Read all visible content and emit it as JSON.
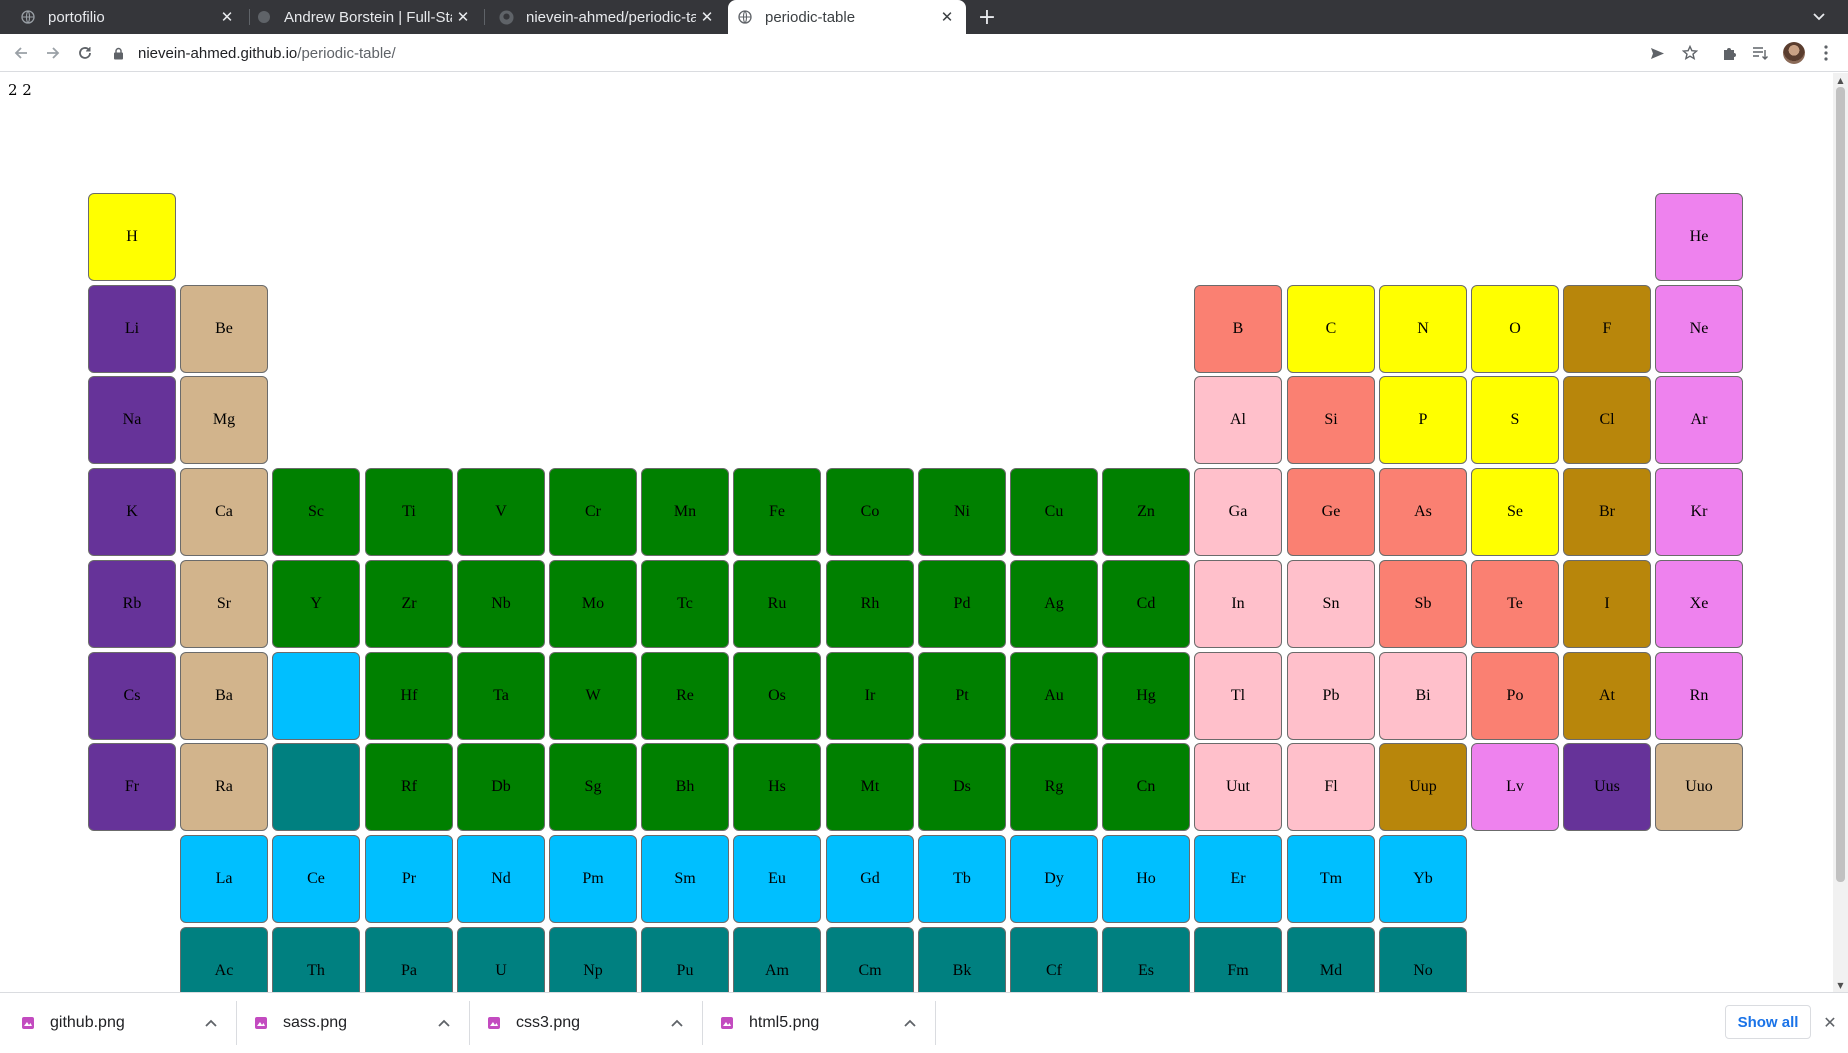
{
  "tabs": [
    {
      "title": "portofilio",
      "close": "✕"
    },
    {
      "title": "Andrew Borstein | Full-Stack",
      "close": "✕"
    },
    {
      "title": "nievein-ahmed/periodic-table",
      "close": "✕"
    },
    {
      "title": "periodic-table",
      "close": "✕",
      "active": true
    }
  ],
  "toolbar": {
    "url_host": "nievein-ahmed.github.io",
    "url_path": "/periodic-table/"
  },
  "page": {
    "corner_text": "2 2"
  },
  "colors": {
    "alkali": "#663399",
    "alkaline": "#d2b48c",
    "transition": "#008000",
    "lanthanide": "#00bfff",
    "actinide": "#008080",
    "metalloid": "#fa8072",
    "post_transition": "#ffc0cb",
    "nonmetal": "#ffff00",
    "halogen": "#b8860b",
    "noble": "#ee82ee"
  },
  "elements": [
    {
      "symbol": "H",
      "row": 1,
      "col": 1,
      "group": "nonmetal"
    },
    {
      "symbol": "He",
      "row": 1,
      "col": 18,
      "group": "noble"
    },
    {
      "symbol": "Li",
      "row": 2,
      "col": 1,
      "group": "alkali"
    },
    {
      "symbol": "Be",
      "row": 2,
      "col": 2,
      "group": "alkaline"
    },
    {
      "symbol": "B",
      "row": 2,
      "col": 13,
      "group": "metalloid"
    },
    {
      "symbol": "C",
      "row": 2,
      "col": 14,
      "group": "nonmetal"
    },
    {
      "symbol": "N",
      "row": 2,
      "col": 15,
      "group": "nonmetal"
    },
    {
      "symbol": "O",
      "row": 2,
      "col": 16,
      "group": "nonmetal"
    },
    {
      "symbol": "F",
      "row": 2,
      "col": 17,
      "group": "halogen"
    },
    {
      "symbol": "Ne",
      "row": 2,
      "col": 18,
      "group": "noble"
    },
    {
      "symbol": "Na",
      "row": 3,
      "col": 1,
      "group": "alkali"
    },
    {
      "symbol": "Mg",
      "row": 3,
      "col": 2,
      "group": "alkaline"
    },
    {
      "symbol": "Al",
      "row": 3,
      "col": 13,
      "group": "post_transition"
    },
    {
      "symbol": "Si",
      "row": 3,
      "col": 14,
      "group": "metalloid"
    },
    {
      "symbol": "P",
      "row": 3,
      "col": 15,
      "group": "nonmetal"
    },
    {
      "symbol": "S",
      "row": 3,
      "col": 16,
      "group": "nonmetal"
    },
    {
      "symbol": "Cl",
      "row": 3,
      "col": 17,
      "group": "halogen"
    },
    {
      "symbol": "Ar",
      "row": 3,
      "col": 18,
      "group": "noble"
    },
    {
      "symbol": "K",
      "row": 4,
      "col": 1,
      "group": "alkali"
    },
    {
      "symbol": "Ca",
      "row": 4,
      "col": 2,
      "group": "alkaline"
    },
    {
      "symbol": "Sc",
      "row": 4,
      "col": 3,
      "group": "transition"
    },
    {
      "symbol": "Ti",
      "row": 4,
      "col": 4,
      "group": "transition"
    },
    {
      "symbol": "V",
      "row": 4,
      "col": 5,
      "group": "transition"
    },
    {
      "symbol": "Cr",
      "row": 4,
      "col": 6,
      "group": "transition"
    },
    {
      "symbol": "Mn",
      "row": 4,
      "col": 7,
      "group": "transition"
    },
    {
      "symbol": "Fe",
      "row": 4,
      "col": 8,
      "group": "transition"
    },
    {
      "symbol": "Co",
      "row": 4,
      "col": 9,
      "group": "transition"
    },
    {
      "symbol": "Ni",
      "row": 4,
      "col": 10,
      "group": "transition"
    },
    {
      "symbol": "Cu",
      "row": 4,
      "col": 11,
      "group": "transition"
    },
    {
      "symbol": "Zn",
      "row": 4,
      "col": 12,
      "group": "transition"
    },
    {
      "symbol": "Ga",
      "row": 4,
      "col": 13,
      "group": "post_transition"
    },
    {
      "symbol": "Ge",
      "row": 4,
      "col": 14,
      "group": "metalloid"
    },
    {
      "symbol": "As",
      "row": 4,
      "col": 15,
      "group": "metalloid"
    },
    {
      "symbol": "Se",
      "row": 4,
      "col": 16,
      "group": "nonmetal"
    },
    {
      "symbol": "Br",
      "row": 4,
      "col": 17,
      "group": "halogen"
    },
    {
      "symbol": "Kr",
      "row": 4,
      "col": 18,
      "group": "noble"
    },
    {
      "symbol": "Rb",
      "row": 5,
      "col": 1,
      "group": "alkali"
    },
    {
      "symbol": "Sr",
      "row": 5,
      "col": 2,
      "group": "alkaline"
    },
    {
      "symbol": "Y",
      "row": 5,
      "col": 3,
      "group": "transition"
    },
    {
      "symbol": "Zr",
      "row": 5,
      "col": 4,
      "group": "transition"
    },
    {
      "symbol": "Nb",
      "row": 5,
      "col": 5,
      "group": "transition"
    },
    {
      "symbol": "Mo",
      "row": 5,
      "col": 6,
      "group": "transition"
    },
    {
      "symbol": "Tc",
      "row": 5,
      "col": 7,
      "group": "transition"
    },
    {
      "symbol": "Ru",
      "row": 5,
      "col": 8,
      "group": "transition"
    },
    {
      "symbol": "Rh",
      "row": 5,
      "col": 9,
      "group": "transition"
    },
    {
      "symbol": "Pd",
      "row": 5,
      "col": 10,
      "group": "transition"
    },
    {
      "symbol": "Ag",
      "row": 5,
      "col": 11,
      "group": "transition"
    },
    {
      "symbol": "Cd",
      "row": 5,
      "col": 12,
      "group": "transition"
    },
    {
      "symbol": "In",
      "row": 5,
      "col": 13,
      "group": "post_transition"
    },
    {
      "symbol": "Sn",
      "row": 5,
      "col": 14,
      "group": "post_transition"
    },
    {
      "symbol": "Sb",
      "row": 5,
      "col": 15,
      "group": "metalloid"
    },
    {
      "symbol": "Te",
      "row": 5,
      "col": 16,
      "group": "metalloid"
    },
    {
      "symbol": "I",
      "row": 5,
      "col": 17,
      "group": "halogen"
    },
    {
      "symbol": "Xe",
      "row": 5,
      "col": 18,
      "group": "noble"
    },
    {
      "symbol": "Cs",
      "row": 6,
      "col": 1,
      "group": "alkali"
    },
    {
      "symbol": "Ba",
      "row": 6,
      "col": 2,
      "group": "alkaline"
    },
    {
      "symbol": "",
      "row": 6,
      "col": 3,
      "group": "lanthanide"
    },
    {
      "symbol": "Hf",
      "row": 6,
      "col": 4,
      "group": "transition"
    },
    {
      "symbol": "Ta",
      "row": 6,
      "col": 5,
      "group": "transition"
    },
    {
      "symbol": "W",
      "row": 6,
      "col": 6,
      "group": "transition"
    },
    {
      "symbol": "Re",
      "row": 6,
      "col": 7,
      "group": "transition"
    },
    {
      "symbol": "Os",
      "row": 6,
      "col": 8,
      "group": "transition"
    },
    {
      "symbol": "Ir",
      "row": 6,
      "col": 9,
      "group": "transition"
    },
    {
      "symbol": "Pt",
      "row": 6,
      "col": 10,
      "group": "transition"
    },
    {
      "symbol": "Au",
      "row": 6,
      "col": 11,
      "group": "transition"
    },
    {
      "symbol": "Hg",
      "row": 6,
      "col": 12,
      "group": "transition"
    },
    {
      "symbol": "Tl",
      "row": 6,
      "col": 13,
      "group": "post_transition"
    },
    {
      "symbol": "Pb",
      "row": 6,
      "col": 14,
      "group": "post_transition"
    },
    {
      "symbol": "Bi",
      "row": 6,
      "col": 15,
      "group": "post_transition"
    },
    {
      "symbol": "Po",
      "row": 6,
      "col": 16,
      "group": "metalloid"
    },
    {
      "symbol": "At",
      "row": 6,
      "col": 17,
      "group": "halogen"
    },
    {
      "symbol": "Rn",
      "row": 6,
      "col": 18,
      "group": "noble"
    },
    {
      "symbol": "Fr",
      "row": 7,
      "col": 1,
      "group": "alkali"
    },
    {
      "symbol": "Ra",
      "row": 7,
      "col": 2,
      "group": "alkaline"
    },
    {
      "symbol": "",
      "row": 7,
      "col": 3,
      "group": "actinide"
    },
    {
      "symbol": "Rf",
      "row": 7,
      "col": 4,
      "group": "transition"
    },
    {
      "symbol": "Db",
      "row": 7,
      "col": 5,
      "group": "transition"
    },
    {
      "symbol": "Sg",
      "row": 7,
      "col": 6,
      "group": "transition"
    },
    {
      "symbol": "Bh",
      "row": 7,
      "col": 7,
      "group": "transition"
    },
    {
      "symbol": "Hs",
      "row": 7,
      "col": 8,
      "group": "transition"
    },
    {
      "symbol": "Mt",
      "row": 7,
      "col": 9,
      "group": "transition"
    },
    {
      "symbol": "Ds",
      "row": 7,
      "col": 10,
      "group": "transition"
    },
    {
      "symbol": "Rg",
      "row": 7,
      "col": 11,
      "group": "transition"
    },
    {
      "symbol": "Cn",
      "row": 7,
      "col": 12,
      "group": "transition"
    },
    {
      "symbol": "Uut",
      "row": 7,
      "col": 13,
      "group": "post_transition"
    },
    {
      "symbol": "Fl",
      "row": 7,
      "col": 14,
      "group": "post_transition"
    },
    {
      "symbol": "Uup",
      "row": 7,
      "col": 15,
      "group": "halogen"
    },
    {
      "symbol": "Lv",
      "row": 7,
      "col": 16,
      "group": "noble"
    },
    {
      "symbol": "Uus",
      "row": 7,
      "col": 17,
      "group": "alkali"
    },
    {
      "symbol": "Uuo",
      "row": 7,
      "col": 18,
      "group": "alkaline"
    },
    {
      "symbol": "La",
      "row": 8,
      "col": 2,
      "group": "lanthanide"
    },
    {
      "symbol": "Ce",
      "row": 8,
      "col": 3,
      "group": "lanthanide"
    },
    {
      "symbol": "Pr",
      "row": 8,
      "col": 4,
      "group": "lanthanide"
    },
    {
      "symbol": "Nd",
      "row": 8,
      "col": 5,
      "group": "lanthanide"
    },
    {
      "symbol": "Pm",
      "row": 8,
      "col": 6,
      "group": "lanthanide"
    },
    {
      "symbol": "Sm",
      "row": 8,
      "col": 7,
      "group": "lanthanide"
    },
    {
      "symbol": "Eu",
      "row": 8,
      "col": 8,
      "group": "lanthanide"
    },
    {
      "symbol": "Gd",
      "row": 8,
      "col": 9,
      "group": "lanthanide"
    },
    {
      "symbol": "Tb",
      "row": 8,
      "col": 10,
      "group": "lanthanide"
    },
    {
      "symbol": "Dy",
      "row": 8,
      "col": 11,
      "group": "lanthanide"
    },
    {
      "symbol": "Ho",
      "row": 8,
      "col": 12,
      "group": "lanthanide"
    },
    {
      "symbol": "Er",
      "row": 8,
      "col": 13,
      "group": "lanthanide"
    },
    {
      "symbol": "Tm",
      "row": 8,
      "col": 14,
      "group": "lanthanide"
    },
    {
      "symbol": "Yb",
      "row": 8,
      "col": 15,
      "group": "lanthanide"
    },
    {
      "symbol": "Ac",
      "row": 9,
      "col": 2,
      "group": "actinide"
    },
    {
      "symbol": "Th",
      "row": 9,
      "col": 3,
      "group": "actinide"
    },
    {
      "symbol": "Pa",
      "row": 9,
      "col": 4,
      "group": "actinide"
    },
    {
      "symbol": "U",
      "row": 9,
      "col": 5,
      "group": "actinide"
    },
    {
      "symbol": "Np",
      "row": 9,
      "col": 6,
      "group": "actinide"
    },
    {
      "symbol": "Pu",
      "row": 9,
      "col": 7,
      "group": "actinide"
    },
    {
      "symbol": "Am",
      "row": 9,
      "col": 8,
      "group": "actinide"
    },
    {
      "symbol": "Cm",
      "row": 9,
      "col": 9,
      "group": "actinide"
    },
    {
      "symbol": "Bk",
      "row": 9,
      "col": 10,
      "group": "actinide"
    },
    {
      "symbol": "Cf",
      "row": 9,
      "col": 11,
      "group": "actinide"
    },
    {
      "symbol": "Es",
      "row": 9,
      "col": 12,
      "group": "actinide"
    },
    {
      "symbol": "Fm",
      "row": 9,
      "col": 13,
      "group": "actinide"
    },
    {
      "symbol": "Md",
      "row": 9,
      "col": 14,
      "group": "actinide"
    },
    {
      "symbol": "No",
      "row": 9,
      "col": 15,
      "group": "actinide"
    }
  ],
  "downloads": {
    "items": [
      {
        "name": "github.png"
      },
      {
        "name": "sass.png"
      },
      {
        "name": "css3.png"
      },
      {
        "name": "html5.png"
      }
    ],
    "show_all": "Show all"
  }
}
